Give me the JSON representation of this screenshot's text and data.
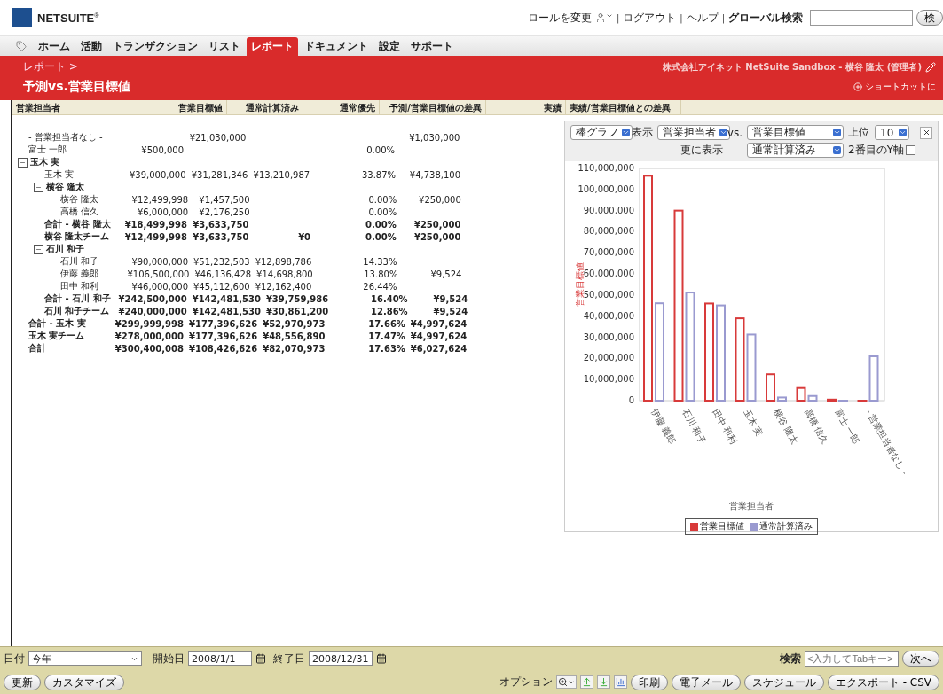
{
  "header": {
    "logo": "NETSUITE$^{®}$",
    "links": [
      {
        "label": "ロールを変更",
        "kind": "role"
      },
      {
        "label": "ログアウト",
        "kind": "link"
      },
      {
        "label": "ヘルプ",
        "kind": "link"
      },
      {
        "label": "グローバル検索",
        "kind": "label"
      }
    ],
    "separator": "|",
    "search_button": "検"
  },
  "nav": [
    {
      "label": "ホーム",
      "selected": false
    },
    {
      "label": "活動",
      "selected": false
    },
    {
      "label": "トランザクション",
      "selected": false
    },
    {
      "label": "リスト",
      "selected": false
    },
    {
      "label": "レポート",
      "selected": true
    },
    {
      "label": "ドキュメント",
      "selected": false
    },
    {
      "label": "設定",
      "selected": false
    },
    {
      "label": "サポート",
      "selected": false
    }
  ],
  "banner": {
    "breadcrumb": "レポート >",
    "account": "株式会社アイネット NetSuite Sandbox - 横谷 隆太 (管理者)",
    "title": "予測vs.営業目標値",
    "shortcut": "ショートカットに"
  },
  "table": {
    "columns": [
      "営業担当者",
      "営業目標値",
      "通常計算済み",
      "通常優先",
      "予測/営業目標値の差異",
      "実績",
      "実績/営業目標値との差異"
    ],
    "rows": [
      {
        "name": "- 営業担当者なし -",
        "bold": false,
        "cells": [
          null,
          "¥21,030,000",
          null,
          null,
          "¥1,030,000",
          null
        ]
      },
      {
        "name": "富士 一郎",
        "bold": false,
        "cells": [
          "¥500,000",
          null,
          null,
          "0.00%",
          null,
          null
        ]
      },
      {
        "name": "玉木 実",
        "kind": "group",
        "expanded": true,
        "children": [
          {
            "name": "玉木 実",
            "bold": false,
            "cells": [
              "¥39,000,000",
              "¥31,281,346",
              "¥13,210,987",
              "33.87%",
              "¥4,738,100",
              null
            ]
          },
          {
            "name": "横谷 隆太",
            "kind": "group",
            "expanded": true,
            "children": [
              {
                "name": "横谷 隆太",
                "bold": false,
                "cells": [
                  "¥12,499,998",
                  "¥1,457,500",
                  null,
                  "0.00%",
                  "¥250,000",
                  null
                ]
              },
              {
                "name": "高橋 信久",
                "bold": false,
                "cells": [
                  "¥6,000,000",
                  "¥2,176,250",
                  null,
                  "0.00%",
                  null,
                  null
                ]
              }
            ]
          },
          {
            "name": "合計 - 横谷 隆太",
            "bold": true,
            "cells": [
              "¥18,499,998",
              "¥3,633,750",
              null,
              "0.00%",
              "¥250,000",
              null
            ]
          },
          {
            "name": "横谷 隆太チーム",
            "bold": true,
            "cells": [
              "¥12,499,998",
              "¥3,633,750",
              "¥0",
              "0.00%",
              "¥250,000",
              null
            ]
          },
          {
            "name": "石川 和子",
            "kind": "group",
            "expanded": true,
            "children": [
              {
                "name": "石川 和子",
                "bold": false,
                "cells": [
                  "¥90,000,000",
                  "¥51,232,503",
                  "¥12,898,786",
                  "14.33%",
                  null,
                  null
                ]
              },
              {
                "name": "伊藤 義郎",
                "bold": false,
                "cells": [
                  "¥106,500,000",
                  "¥46,136,428",
                  "¥14,698,800",
                  "13.80%",
                  "¥9,524",
                  null
                ]
              },
              {
                "name": "田中 和利",
                "bold": false,
                "cells": [
                  "¥46,000,000",
                  "¥45,112,600",
                  "¥12,162,400",
                  "26.44%",
                  null,
                  null
                ]
              }
            ]
          },
          {
            "name": "合計 - 石川 和子",
            "bold": true,
            "cells": [
              "¥242,500,000",
              "¥142,481,530",
              "¥39,759,986",
              "16.40%",
              "¥9,524",
              null
            ]
          },
          {
            "name": "石川 和子チーム",
            "bold": true,
            "cells": [
              "¥240,000,000",
              "¥142,481,530",
              "¥30,861,200",
              "12.86%",
              "¥9,524",
              null
            ]
          }
        ]
      },
      {
        "name": "合計 - 玉木 実",
        "bold": true,
        "cells": [
          "¥299,999,998",
          "¥177,396,626",
          "¥52,970,973",
          "17.66%",
          "¥4,997,624",
          null
        ]
      },
      {
        "name": "玉木 実チーム",
        "bold": true,
        "cells": [
          "¥278,000,000",
          "¥177,396,626",
          "¥48,556,890",
          "17.47%",
          "¥4,997,624",
          null
        ]
      },
      {
        "name": "合計",
        "bold": true,
        "cells": [
          "¥300,400,008",
          "¥108,426,626",
          "¥82,070,973",
          "17.63%",
          "¥6,027,624",
          null
        ]
      }
    ]
  },
  "chart_panel": {
    "chart_type": "棒グラフ",
    "show_label": "表示",
    "show_value": "営業担当者",
    "vs_label": "vs.",
    "vs_value": "営業目標値",
    "top_label": "上位",
    "top_value": "10",
    "more_label": "更に表示",
    "more_value": "通常計算済み",
    "second_axis": {
      "label": "2番目のY軸",
      "checked": false
    },
    "chart_data": {
      "type": "bar",
      "xlabel": "営業担当者",
      "ylabel": "営業目標値",
      "categories": [
        "伊藤 義郎",
        "石川 和子",
        "田中 和利",
        "玉木 実",
        "横谷 隆太",
        "高橋 信久",
        "富士 一郎",
        "- 営業担当者なし -"
      ],
      "series": [
        {
          "name": "営業目標値",
          "color": "#d83a3a",
          "values": [
            106500000,
            90000000,
            46000000,
            39000000,
            12500000,
            6000000,
            500000,
            0
          ]
        },
        {
          "name": "通常計算済み",
          "color": "#9a9ad0",
          "values": [
            46100000,
            51200000,
            45100000,
            31300000,
            1500000,
            2200000,
            0,
            21000000
          ]
        }
      ],
      "ylim": [
        0,
        110000000
      ],
      "yticks": [
        {
          "value": 0,
          "label": "0"
        },
        {
          "value": 10000000,
          "label": "10,000,000"
        },
        {
          "value": 20000000,
          "label": "20,000,000"
        },
        {
          "value": 30000000,
          "label": "30,000,000"
        },
        {
          "value": 40000000,
          "label": "40,000,000"
        },
        {
          "value": 50000000,
          "label": "50,000,000"
        },
        {
          "value": 60000000,
          "label": "60,000,000"
        },
        {
          "value": 70000000,
          "label": "70,000,000"
        },
        {
          "value": 80000000,
          "label": "80,000,000"
        },
        {
          "value": 90000000,
          "label": "90,000,000"
        },
        {
          "value": 100000000,
          "label": "100,000,000"
        },
        {
          "value": 110000000,
          "label": "110,000,000"
        }
      ]
    }
  },
  "footer": {
    "date_label": "日付",
    "date_value": "今年",
    "start_label": "開始日",
    "start_value": "2008/1/1",
    "end_label": "終了日",
    "end_value": "2008/12/31",
    "search_label": "検索",
    "search_placeholder": "<入力してTabキー>",
    "next_button": "次へ",
    "refresh_button": "更新",
    "customize_button": "カスタマイズ",
    "options_label": "オプション",
    "actions": [
      "印刷",
      "電子メール",
      "スケジュール",
      "エクスポート - CSV"
    ]
  }
}
